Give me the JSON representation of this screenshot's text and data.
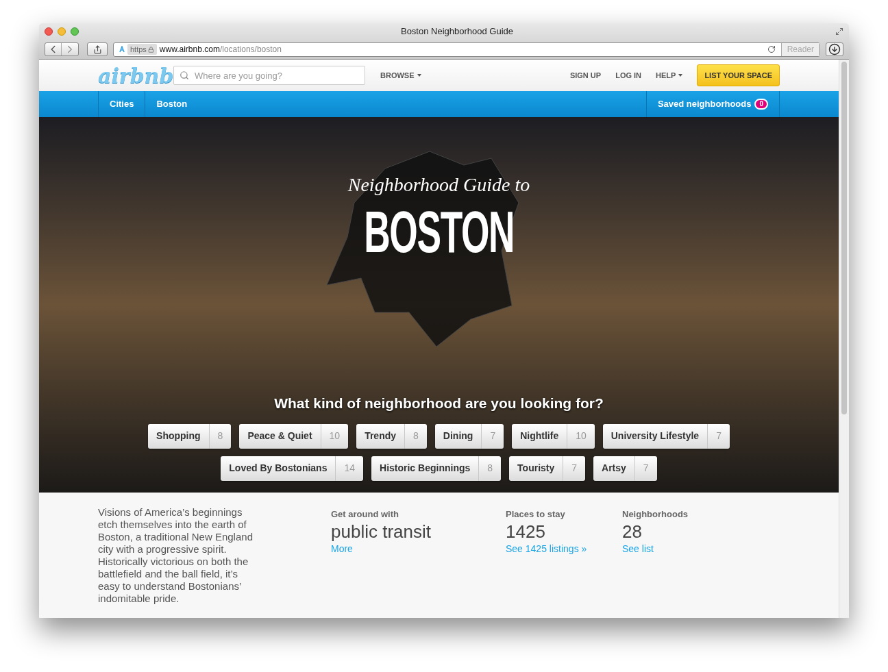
{
  "window": {
    "title": "Boston Neighborhood Guide"
  },
  "address_bar": {
    "scheme": "https",
    "domain": "www.airbnb.com",
    "path": "/locations/boston",
    "reader": "Reader"
  },
  "header": {
    "logo": "airbnb",
    "search": {
      "placeholder": "Where are you going?"
    },
    "browse": "BROWSE",
    "links": [
      {
        "label": "SIGN UP",
        "menu": false
      },
      {
        "label": "LOG IN",
        "menu": false
      },
      {
        "label": "HELP",
        "menu": true
      }
    ],
    "cta": "LIST YOUR SPACE"
  },
  "nav": {
    "breadcrumbs": [
      "Cities",
      "Boston"
    ],
    "saved": {
      "label": "Saved neighborhoods",
      "count": "0"
    }
  },
  "hero": {
    "script_title": "Neighborhood Guide to",
    "title": "BOSTON",
    "question": "What kind of neighborhood are you looking for?",
    "tag_rows": [
      [
        {
          "label": "Shopping",
          "count": "8"
        },
        {
          "label": "Peace & Quiet",
          "count": "10"
        },
        {
          "label": "Trendy",
          "count": "8"
        },
        {
          "label": "Dining",
          "count": "7"
        },
        {
          "label": "Nightlife",
          "count": "10"
        },
        {
          "label": "University Lifestyle",
          "count": "7"
        }
      ],
      [
        {
          "label": "Loved By Bostonians",
          "count": "14"
        },
        {
          "label": "Historic Beginnings",
          "count": "8"
        },
        {
          "label": "Touristy",
          "count": "7"
        },
        {
          "label": "Artsy",
          "count": "7"
        }
      ]
    ]
  },
  "info": {
    "description": "Visions of America’s beginnings etch themselves into the earth of Boston, a traditional New England city with a progressive spirit. Historically victorious on both the battlefield and the ball field, it’s easy to understand Bostonians’ indomitable pride.",
    "stats": [
      {
        "label": "Get around with",
        "value": "public transit",
        "link": "More"
      },
      {
        "label": "Places to stay",
        "value": "1425",
        "link": "See 1425 listings »"
      },
      {
        "label": "Neighborhoods",
        "value": "28",
        "link": "See list"
      }
    ]
  }
}
